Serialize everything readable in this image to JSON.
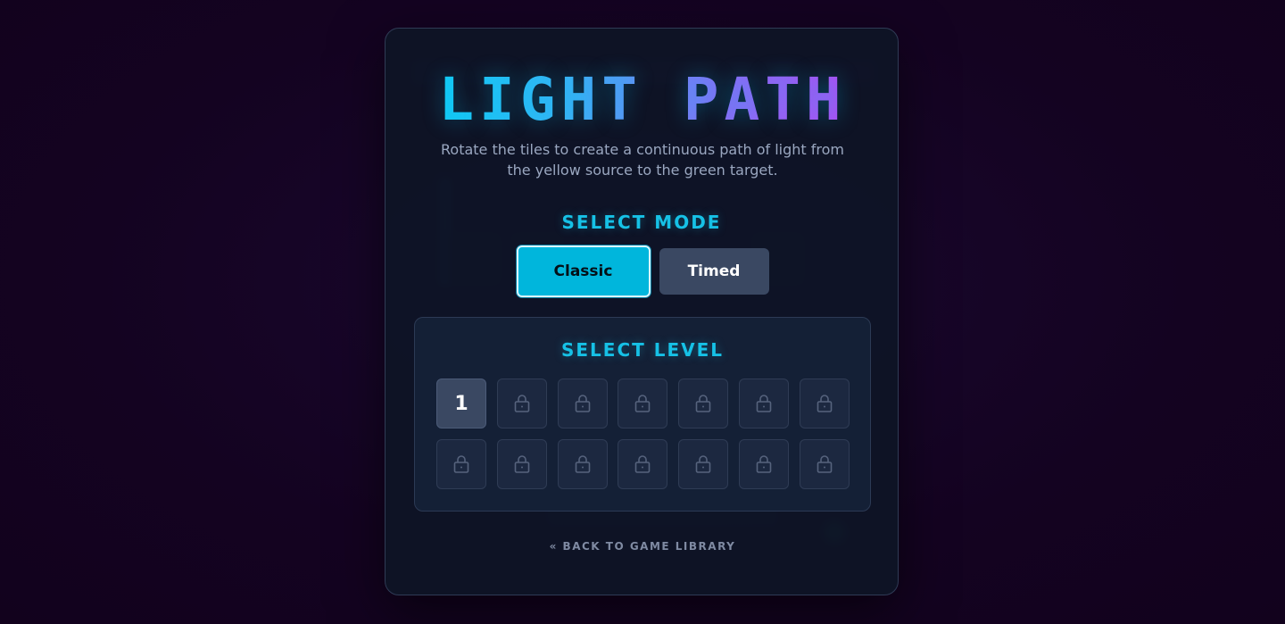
{
  "game": {
    "title": "LIGHT PATH",
    "subtitle": "Rotate the tiles to create a continuous path of light from the yellow source to the green target."
  },
  "mode_select": {
    "label": "SELECT MODE",
    "selected": "Classic",
    "options": [
      {
        "label": "Classic",
        "active": true
      },
      {
        "label": "Timed",
        "active": false
      }
    ]
  },
  "level_select": {
    "label": "SELECT LEVEL",
    "levels": [
      {
        "label": "1",
        "locked": false
      },
      {
        "locked": true
      },
      {
        "locked": true
      },
      {
        "locked": true
      },
      {
        "locked": true
      },
      {
        "locked": true
      },
      {
        "locked": true
      },
      {
        "locked": true
      },
      {
        "locked": true
      },
      {
        "locked": true
      },
      {
        "locked": true
      },
      {
        "locked": true
      },
      {
        "locked": true
      },
      {
        "locked": true
      }
    ],
    "locked_icon": "lock-icon"
  },
  "footer": {
    "back_label": "« BACK TO GAME LIBRARY"
  },
  "colors": {
    "background": "#140321",
    "panel": "#0e1426",
    "accent": "#00b6dc",
    "title_gradient_start": "#00d4f5",
    "title_gradient_end": "#c33cf2",
    "source": "yellow",
    "target": "#1db97a"
  }
}
